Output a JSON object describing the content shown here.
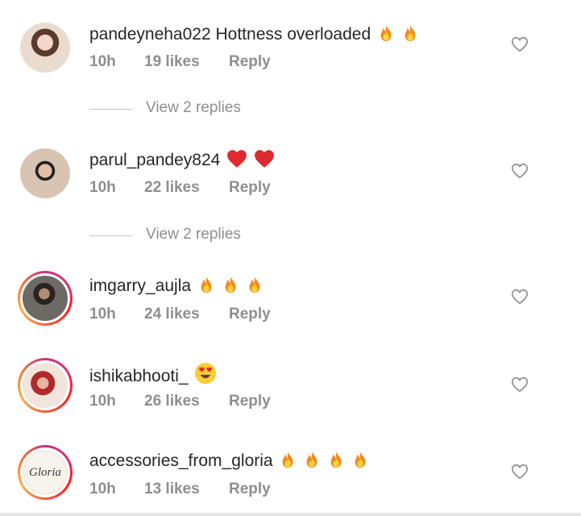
{
  "comments": [
    {
      "username": "pandeyneha022",
      "text": "Hottness overloaded",
      "emoji": [
        "fire",
        "fire"
      ],
      "time": "10h",
      "likes": "19 likes",
      "reply": "Reply",
      "replies": "View 2 replies"
    },
    {
      "username": "parul_pandey824",
      "text": "",
      "emoji": [
        "heart",
        "heart"
      ],
      "time": "10h",
      "likes": "22 likes",
      "reply": "Reply",
      "replies": "View 2 replies"
    },
    {
      "username": "imgarry_aujla",
      "text": "",
      "emoji": [
        "fire",
        "fire",
        "fire"
      ],
      "time": "10h",
      "likes": "24 likes",
      "reply": "Reply"
    },
    {
      "username": "ishikabhooti_",
      "text": "",
      "emoji": [
        "heart-eyes"
      ],
      "time": "10h",
      "likes": "26 likes",
      "reply": "Reply"
    },
    {
      "username": "accessories_from_gloria",
      "text": "",
      "emoji": [
        "fire",
        "fire",
        "fire",
        "fire"
      ],
      "time": "10h",
      "likes": "13 likes",
      "reply": "Reply",
      "avatar_text": "Gloria"
    }
  ],
  "colors": {
    "text": "#262626",
    "secondary": "#8e8e8e",
    "fire": "#f5a623",
    "red": "#e0262b"
  }
}
